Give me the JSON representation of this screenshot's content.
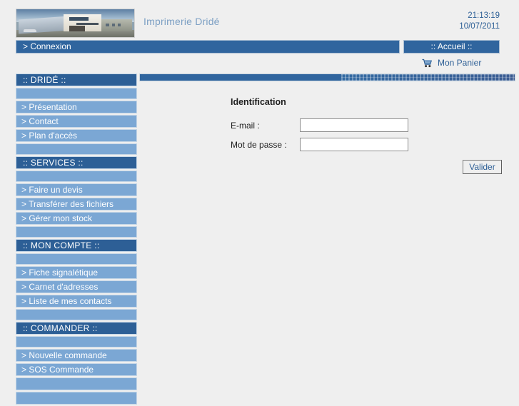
{
  "header": {
    "logo_alt": "imprimerie-dride-building-photo",
    "site_title": "Imprimerie Dridé",
    "time": "21:13:19",
    "date": "10/07/2011"
  },
  "topnav": {
    "connexion_label": "> Connexion",
    "accueil_label": ":: Accueil ::",
    "cart_label": "Mon Panier",
    "cart_icon": "shopping-cart-icon"
  },
  "sidebar": {
    "groups": [
      {
        "title": ":: DRIDÉ ::",
        "items": [
          "> Présentation",
          "> Contact",
          "> Plan d'accès"
        ]
      },
      {
        "title": ":: SERVICES ::",
        "items": [
          "> Faire un devis",
          "> Transférer des fichiers",
          "> Gérer mon stock"
        ]
      },
      {
        "title": ":: MON COMPTE ::",
        "items": [
          "> Fiche signalétique",
          "> Carnet d'adresses",
          "> Liste de mes contacts"
        ]
      },
      {
        "title": ":: COMMANDER ::",
        "items": [
          "> Nouvelle commande",
          "> SOS Commande"
        ]
      }
    ]
  },
  "main": {
    "form_title": "Identification",
    "email_label": "E-mail :",
    "email_value": "",
    "email_placeholder": "",
    "password_label": "Mot de passe :",
    "password_value": "",
    "password_placeholder": "",
    "submit_label": "Valider"
  },
  "colors": {
    "dark_blue": "#2d5f96",
    "nav_blue": "#30659e",
    "light_blue": "#7ba7d4",
    "page_bg": "#efefef",
    "title_blue": "#7da0c4",
    "border_blue": "#c5d6e6"
  }
}
